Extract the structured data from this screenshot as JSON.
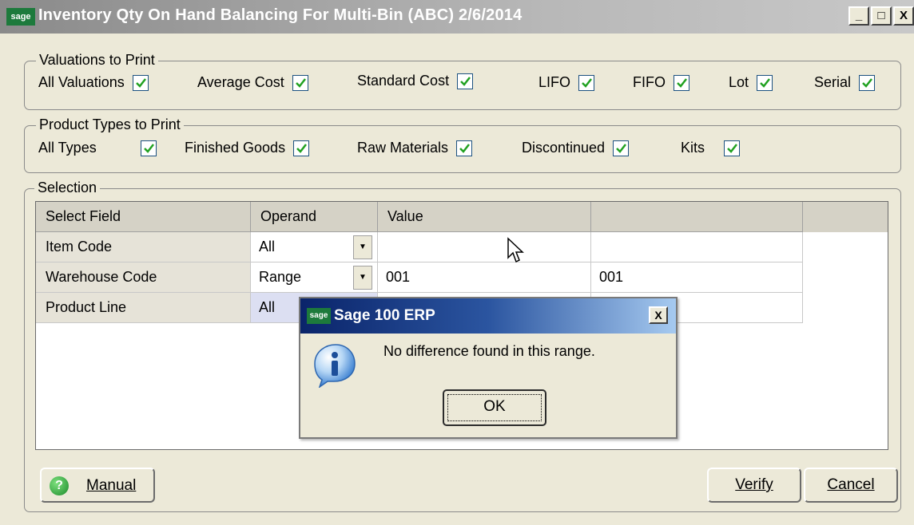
{
  "window": {
    "logo": "sage",
    "title": "Inventory Qty On Hand Balancing For Multi-Bin (ABC) 2/6/2014",
    "minimize": "_",
    "maximize": "□",
    "close": "X"
  },
  "valuations": {
    "label": "Valuations to Print",
    "options": [
      {
        "label": "All Valuations",
        "checked": true
      },
      {
        "label": "Average Cost",
        "checked": true
      },
      {
        "label": "Standard Cost",
        "checked": true
      },
      {
        "label": "LIFO",
        "checked": true
      },
      {
        "label": "FIFO",
        "checked": true
      },
      {
        "label": "Lot",
        "checked": true
      },
      {
        "label": "Serial",
        "checked": true
      }
    ]
  },
  "product_types": {
    "label": "Product Types to Print",
    "options": [
      {
        "label": "All Types",
        "checked": true
      },
      {
        "label": "Finished Goods",
        "checked": true
      },
      {
        "label": "Raw Materials",
        "checked": true
      },
      {
        "label": "Discontinued",
        "checked": true
      },
      {
        "label": "Kits",
        "checked": true
      }
    ]
  },
  "selection": {
    "label": "Selection",
    "columns": [
      "Select Field",
      "Operand",
      "Value",
      ""
    ],
    "rows": [
      {
        "field": "Item Code",
        "operand": "All",
        "value1": "",
        "value2": ""
      },
      {
        "field": "Warehouse Code",
        "operand": "Range",
        "value1": "001",
        "value2": "001"
      },
      {
        "field": "Product Line",
        "operand": "All",
        "value1": "",
        "value2": ""
      }
    ]
  },
  "buttons": {
    "manual": "Manual",
    "verify": "Verify",
    "cancel": "Cancel"
  },
  "dialog": {
    "logo": "sage",
    "title": "Sage 100 ERP",
    "close": "X",
    "message": "No difference found in this range.",
    "ok": "OK",
    "icon": "info-icon"
  }
}
